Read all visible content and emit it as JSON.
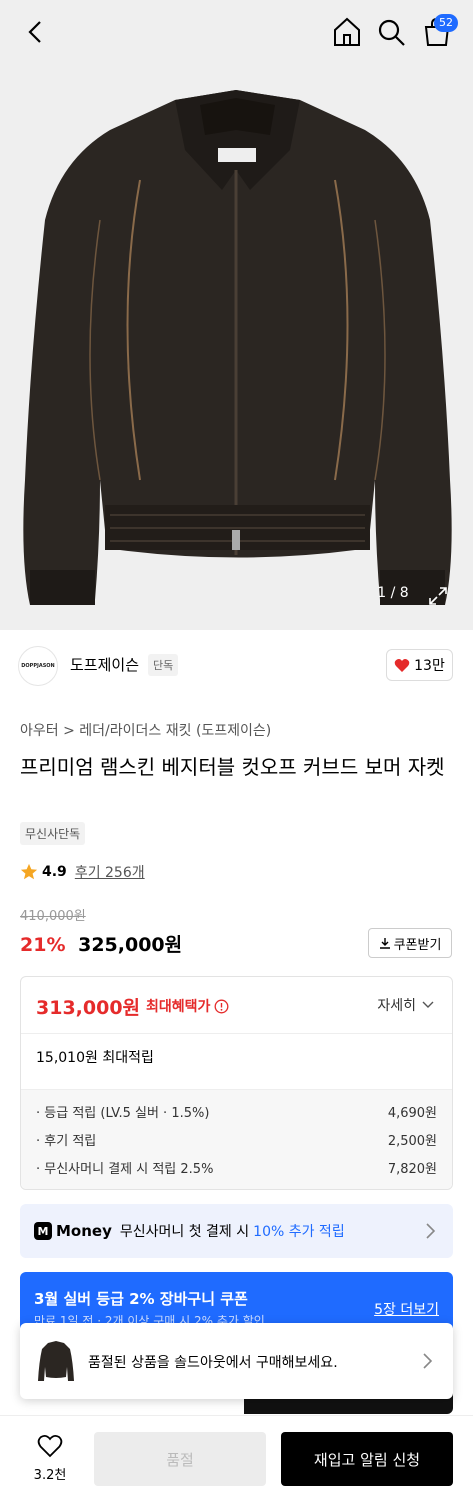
{
  "header": {
    "cart_count": "52"
  },
  "hero": {
    "image_counter": "1 / 8"
  },
  "brand": {
    "logo_text": "DOPPJASON",
    "name": "도프제이슨",
    "exclusive_tag": "단독",
    "likes": "13만"
  },
  "breadcrumb": {
    "category": "아우터",
    "separator": ">",
    "subcategory": "레더/라이더스 재킷 (도프제이슨)"
  },
  "product": {
    "title": "프리미엄 램스킨 베지터블 컷오프 커브드 보머 자켓",
    "tag": "무신사단독",
    "rating": "4.9",
    "reviews": "후기 256개",
    "original_price": "410,000원",
    "discount": "21%",
    "price": "325,000원",
    "coupon_button": "쿠폰받기"
  },
  "benefit": {
    "max_price": "313,000원",
    "max_label": "최대혜택가",
    "detail_label": "자세히",
    "max_points": "15,010원 최대적립",
    "rows": [
      {
        "label": "· 등급 적립 (LV.5 실버 · 1.5%)",
        "value": "4,690원"
      },
      {
        "label": "· 후기 적립",
        "value": "2,500원"
      },
      {
        "label": "· 무신사머니 결제 시 적립 2.5%",
        "value": "7,820원"
      }
    ]
  },
  "money_banner": {
    "logo": "M",
    "brand": "Money",
    "text": "무신사머니 첫 결제 시",
    "highlight": "10% 추가 적립"
  },
  "coupon_banner": {
    "title": "3월 실버 등급 2% 장바구니 쿠폰",
    "subtitle": "만료 1일 전 · 2개 이상 구매 시 2% 추가 할인",
    "more": "5장 더보기"
  },
  "soldout_popup": {
    "message": "품절된 상품을 솔드아웃에서 구매해보세요."
  },
  "bottom_bar": {
    "wish_count": "3.2천",
    "soldout_label": "품절",
    "restock_label": "재입고 알림 신청"
  },
  "colors": {
    "accent_blue": "#1f6bff",
    "sale_red": "#e52b2b"
  }
}
